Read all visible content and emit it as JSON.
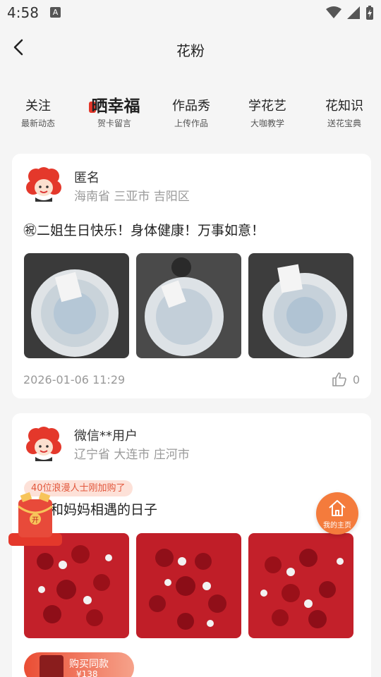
{
  "status": {
    "time": "4:58",
    "a_label": "A"
  },
  "header": {
    "title": "花粉"
  },
  "tabs": [
    {
      "main": "关注",
      "sub": "最新动态",
      "active": false
    },
    {
      "main": "晒幸福",
      "sub": "贺卡留言",
      "active": true
    },
    {
      "main": "作品秀",
      "sub": "上传作品",
      "active": false
    },
    {
      "main": "学花艺",
      "sub": "大咖教学",
      "active": false
    },
    {
      "main": "花知识",
      "sub": "送花宝典",
      "active": false
    }
  ],
  "posts": [
    {
      "user": "匿名",
      "location": "海南省 三亚市 吉阳区",
      "message": "㊗二姐生日快乐！身体健康！万事如意！",
      "date": "2026-01-06 11:29",
      "likes": "0"
    },
    {
      "user": "微信**用户",
      "location": "辽宁省 大连市 庄河市",
      "message": "纪念和妈妈相遇的日子"
    }
  ],
  "promo": {
    "text": "40位浪漫人士刚加购了"
  },
  "redpack": {
    "label": "开"
  },
  "home_fab": {
    "label": "我的主页"
  },
  "buy": {
    "label": "购买同款",
    "price": "¥138"
  },
  "colors": {
    "accent": "#e4382b",
    "fab": "#f47b3c"
  }
}
